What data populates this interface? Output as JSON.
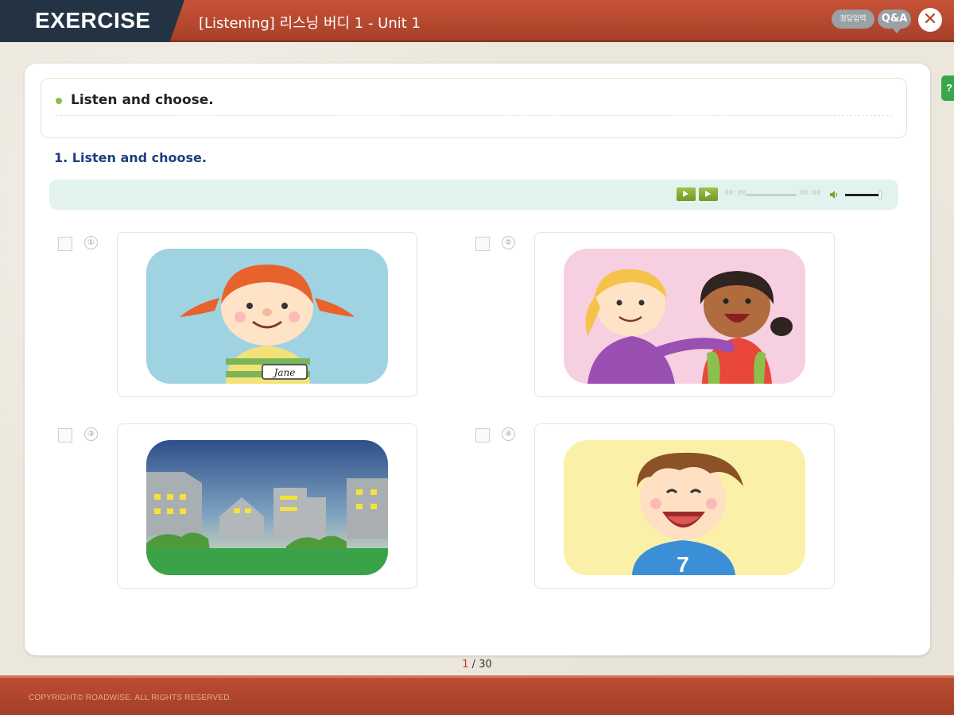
{
  "header": {
    "section_label": "EXERCISE",
    "title": "[Listening] 리스닝 버디 1 - Unit 1",
    "answer_button": "정답입력",
    "qa_button": "Q&A",
    "close_icon": "close-icon",
    "close_glyph": "✕"
  },
  "help_tab": {
    "label": "?"
  },
  "instruction": {
    "text": "Listen and choose."
  },
  "question": {
    "title": "1. Listen and choose."
  },
  "audio_player": {
    "time_start": "00:00",
    "time_end": "00:00",
    "progress": 0,
    "volume": 1,
    "icons": [
      "play-icon",
      "next-icon",
      "volume-icon"
    ]
  },
  "options": [
    {
      "number": "①",
      "checked": false,
      "image": "girl-with-pigtails-name-tag",
      "name_tag": "Jane"
    },
    {
      "number": "②",
      "checked": false,
      "image": "two-girls-friends"
    },
    {
      "number": "③",
      "checked": false,
      "image": "city-buildings-at-night"
    },
    {
      "number": "④",
      "checked": false,
      "image": "smiling-boy",
      "shirt_number": "7"
    }
  ],
  "pager": {
    "current": "1",
    "separator": " / ",
    "total": "30"
  },
  "footer": {
    "copyright": "COPYRIGHT© ROADWISE. ALL RIGHTS RESERVED."
  },
  "colors": {
    "header_bar": "#b8472f",
    "header_tab": "#243344",
    "accent_green": "#8cbf52",
    "question_blue": "#1d3f7e",
    "audio_bar_bg": "#e2f3ef",
    "page_current": "#c23b22"
  }
}
